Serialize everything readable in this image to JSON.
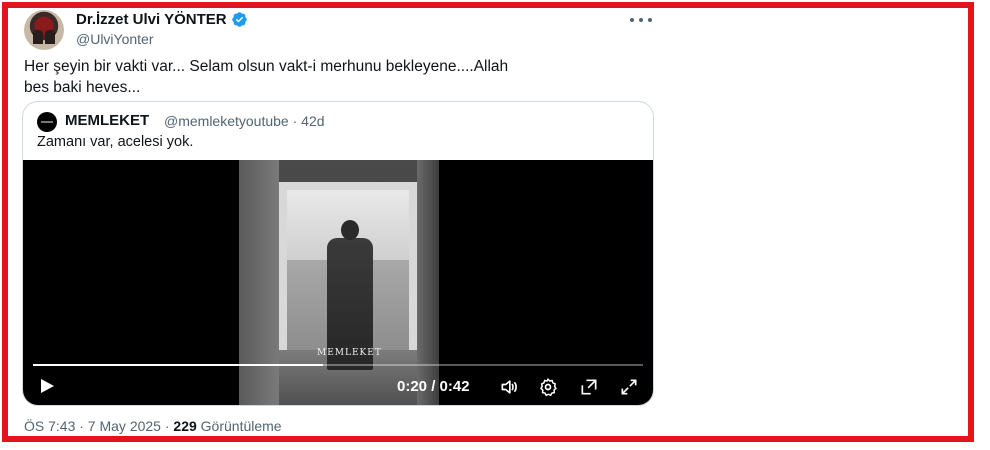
{
  "author": {
    "display_name": "Dr.İzzet Ulvi YÖNTER",
    "handle": "@UlviYonter"
  },
  "tweet": {
    "text_line1": "Her şeyin bir vakti var... Selam olsun vakt-i merhunu bekleyene....Allah",
    "text_line2": "bes baki heves..."
  },
  "quote": {
    "name": "MEMLEKET",
    "handle_time": "@memleketyoutube · 42d",
    "text": "Zamanı var, acelesi yok.",
    "video": {
      "watermark": "MEMLEKET",
      "time": "0:20 / 0:42",
      "progress": 0.476
    }
  },
  "footer": {
    "time_date": "ÖS 7:43 · 7 May 2025 · ",
    "views_count": "229",
    "views_label": " Görüntüleme"
  },
  "colors": {
    "border": "#e4141b",
    "verified": "#1d9bf0",
    "muted_text": "#536471"
  },
  "icons": [
    "verified-badge-icon",
    "more-options-icon",
    "play-icon",
    "volume-icon",
    "settings-gear-icon",
    "pop-out-icon",
    "fullscreen-icon"
  ]
}
